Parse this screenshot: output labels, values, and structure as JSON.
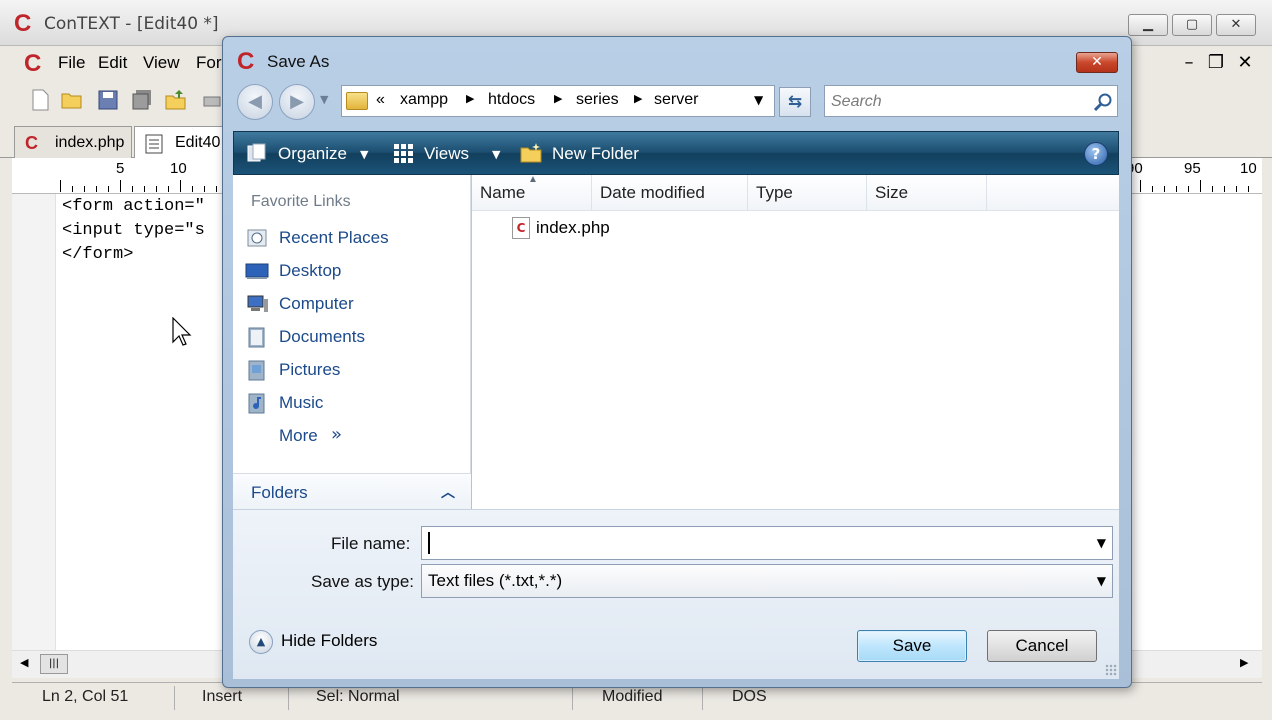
{
  "app": {
    "title": "ConTEXT - [Edit40 *]",
    "menu": [
      "File",
      "Edit",
      "View",
      "For"
    ],
    "tabs": [
      {
        "label": "index.php",
        "active": false
      },
      {
        "label": "Edit40",
        "active": true
      }
    ],
    "ruler_left": [
      "5",
      "10"
    ],
    "ruler_right": [
      "90",
      "95",
      "10"
    ],
    "code_lines": [
      "<form action=\"",
      "<input type=\"s",
      "</form>"
    ],
    "status": {
      "position": "Ln 2, Col 51",
      "mode": "Insert",
      "selection": "Sel: Normal",
      "modified": "Modified",
      "format": "DOS"
    },
    "colors": {
      "logo": "#c0252b"
    }
  },
  "dialog": {
    "title": "Save As",
    "breadcrumbs": [
      "«",
      "xampp",
      "htdocs",
      "series",
      "server"
    ],
    "search_placeholder": "Search",
    "commands": {
      "organize": "Organize",
      "views": "Views",
      "new_folder": "New Folder"
    },
    "favorites_header": "Favorite Links",
    "favorites": [
      {
        "label": "Recent Places",
        "icon": "recent-places-icon"
      },
      {
        "label": "Desktop",
        "icon": "desktop-icon"
      },
      {
        "label": "Computer",
        "icon": "computer-icon"
      },
      {
        "label": "Documents",
        "icon": "documents-icon"
      },
      {
        "label": "Pictures",
        "icon": "pictures-icon"
      },
      {
        "label": "Music",
        "icon": "music-icon"
      }
    ],
    "more_label": "More",
    "more_chevron": "»",
    "folders_label": "Folders",
    "columns": [
      "Name",
      "Date modified",
      "Type",
      "Size"
    ],
    "files": [
      {
        "name": "index.php",
        "icon": "context-file-icon"
      }
    ],
    "file_name_label": "File name:",
    "file_name_value": "",
    "save_as_type_label": "Save as type:",
    "save_as_type_value": "Text files (*.txt,*.*)",
    "hide_folders_label": "Hide Folders",
    "save_label": "Save",
    "cancel_label": "Cancel",
    "colors": {
      "command_bar": "#1c4e70",
      "link": "#1c4a8a"
    }
  }
}
